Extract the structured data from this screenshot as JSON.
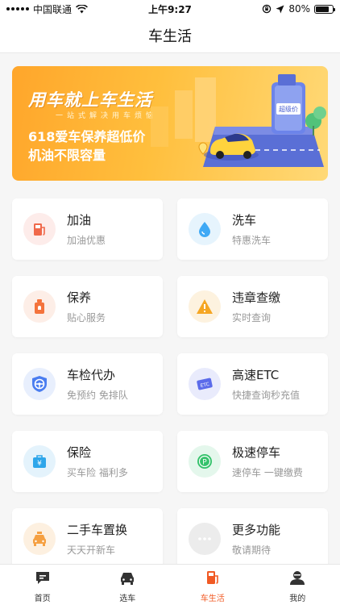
{
  "status_bar": {
    "carrier": "中国联通",
    "time": "上午9:27",
    "battery": "80%",
    "battery_level": 0.8
  },
  "nav": {
    "title": "车生活"
  },
  "banner": {
    "headline": "用车就上车生活",
    "tagline": "一站式解决用车烦恼",
    "promo_line1": "618爱车保养超低价",
    "promo_line2": "机油不限容量",
    "bottle_label": "超级价"
  },
  "services": [
    {
      "title": "加油",
      "subtitle": "加油优惠",
      "icon": "fuel-pump-icon",
      "color": "#f0684a",
      "bg": "#fdecea"
    },
    {
      "title": "洗车",
      "subtitle": "特惠洗车",
      "icon": "water-drop-icon",
      "color": "#3fa9f5",
      "bg": "#e6f4fd"
    },
    {
      "title": "保养",
      "subtitle": "贴心服务",
      "icon": "oil-can-icon",
      "color": "#f4733c",
      "bg": "#fdeee7"
    },
    {
      "title": "违章查缴",
      "subtitle": "实时查询",
      "icon": "warning-icon",
      "color": "#f5a623",
      "bg": "#fdf2df"
    },
    {
      "title": "车检代办",
      "subtitle": "免预约 免排队",
      "icon": "steering-shield-icon",
      "color": "#4a7df0",
      "bg": "#e8effd"
    },
    {
      "title": "高速ETC",
      "subtitle": "快捷查询秒充值",
      "icon": "etc-card-icon",
      "color": "#5b6bea",
      "bg": "#e9ebfc"
    },
    {
      "title": "保险",
      "subtitle": "买车险 福利多",
      "icon": "insurance-bag-icon",
      "color": "#2ea6ea",
      "bg": "#e4f3fc"
    },
    {
      "title": "极速停车",
      "subtitle": "速停车 一键缴费",
      "icon": "parking-icon",
      "color": "#34c26b",
      "bg": "#e4f7ec"
    },
    {
      "title": "二手车置换",
      "subtitle": "天天开新车",
      "icon": "taxi-icon",
      "color": "#f5a042",
      "bg": "#fdf0e0"
    },
    {
      "title": "更多功能",
      "subtitle": "敬请期待",
      "icon": "more-icon",
      "color": "#ffffff",
      "bg": "#ededed"
    }
  ],
  "tabbar": [
    {
      "label": "首页",
      "icon": "chat-bubble-icon",
      "active": false
    },
    {
      "label": "选车",
      "icon": "car-front-icon",
      "active": false
    },
    {
      "label": "车生活",
      "icon": "gas-station-icon",
      "active": true
    },
    {
      "label": "我的",
      "icon": "user-icon",
      "active": false
    }
  ]
}
